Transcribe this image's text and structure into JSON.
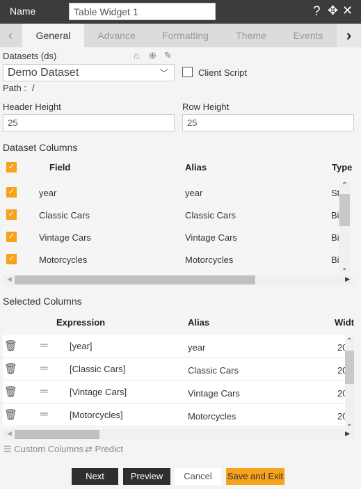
{
  "header": {
    "name_label": "Name",
    "widget_name": "Table Widget 1",
    "icons": [
      "help-icon",
      "move-icon",
      "close-icon"
    ]
  },
  "tabs": [
    {
      "label": "General",
      "active": true
    },
    {
      "label": "Advance"
    },
    {
      "label": "Formatting"
    },
    {
      "label": "Theme"
    },
    {
      "label": "Events"
    }
  ],
  "datasets": {
    "label": "Datasets (ds)",
    "selected": "Demo Dataset",
    "client_script_label": "Client Script",
    "client_script_checked": false,
    "path_label": "Path :",
    "path_value": "/"
  },
  "header_height": {
    "label": "Header Height",
    "value": "25"
  },
  "row_height": {
    "label": "Row Height",
    "value": "25"
  },
  "dataset_columns": {
    "title": "Dataset Columns",
    "headers": [
      "Field",
      "Alias",
      "Type"
    ],
    "rows": [
      {
        "field": "year",
        "alias": "year",
        "type": "St",
        "checked": true
      },
      {
        "field": "Classic Cars",
        "alias": "Classic Cars",
        "type": "Bi",
        "checked": true
      },
      {
        "field": "Vintage Cars",
        "alias": "Vintage Cars",
        "type": "Bi",
        "checked": true
      },
      {
        "field": "Motorcycles",
        "alias": "Motorcycles",
        "type": "Bi",
        "checked": true
      }
    ]
  },
  "selected_columns": {
    "title": "Selected Columns",
    "headers": [
      "Expression",
      "Alias",
      "Widt"
    ],
    "rows": [
      {
        "expression": "[year]",
        "alias": "year",
        "width": "20"
      },
      {
        "expression": "[Classic Cars]",
        "alias": "Classic Cars",
        "width": "20"
      },
      {
        "expression": "[Vintage Cars]",
        "alias": "Vintage Cars",
        "width": "20"
      },
      {
        "expression": "[Motorcycles]",
        "alias": "Motorcycles",
        "width": "20"
      }
    ]
  },
  "links": {
    "custom_columns": "Custom Columns",
    "predict": "Predict"
  },
  "buttons": {
    "next": "Next",
    "preview": "Preview",
    "cancel": "Cancel",
    "save_exit": "Save and Exit"
  },
  "colors": {
    "accent": "#f7a21b",
    "header_bg": "#3c3c3c",
    "dark_button": "#2e2e2e"
  }
}
